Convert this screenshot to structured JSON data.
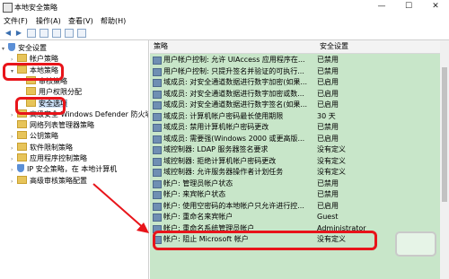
{
  "window": {
    "title": "本地安全策略",
    "min_label": "—",
    "max_label": "☐",
    "close_label": "✕"
  },
  "menu": [
    "文件(F)",
    "操作(A)",
    "查看(V)",
    "帮助(H)"
  ],
  "tree": [
    {
      "label": "安全设置",
      "indent": 0,
      "exp": "▾",
      "icon": "shield"
    },
    {
      "label": "帐户策略",
      "indent": 1,
      "exp": "›",
      "icon": "folder"
    },
    {
      "label": "本地策略",
      "indent": 1,
      "exp": "▾",
      "icon": "folder"
    },
    {
      "label": "审核策略",
      "indent": 2,
      "exp": "",
      "icon": "folder"
    },
    {
      "label": "用户权限分配",
      "indent": 2,
      "exp": "",
      "icon": "folder"
    },
    {
      "label": "安全选项",
      "indent": 2,
      "exp": "",
      "icon": "folder",
      "selected": true
    },
    {
      "label": "高级安全 Windows Defender 防火墙",
      "indent": 1,
      "exp": "›",
      "icon": "folder"
    },
    {
      "label": "网络列表管理器策略",
      "indent": 1,
      "exp": "",
      "icon": "folder"
    },
    {
      "label": "公钥策略",
      "indent": 1,
      "exp": "›",
      "icon": "folder"
    },
    {
      "label": "软件限制策略",
      "indent": 1,
      "exp": "›",
      "icon": "folder"
    },
    {
      "label": "应用程序控制策略",
      "indent": 1,
      "exp": "›",
      "icon": "folder"
    },
    {
      "label": "IP 安全策略，在 本地计算机",
      "indent": 1,
      "exp": "›",
      "icon": "shield"
    },
    {
      "label": "高级审核策略配置",
      "indent": 1,
      "exp": "›",
      "icon": "folder"
    }
  ],
  "columns": {
    "policy": "策略",
    "setting": "安全设置"
  },
  "policies": [
    {
      "name": "用户帐户控制: 允许 UIAccess 应用程序在...",
      "value": "已禁用"
    },
    {
      "name": "用户帐户控制: 只提升签名并验证的可执行...",
      "value": "已禁用"
    },
    {
      "name": "域成员: 对安全通道数据进行数字加密(如果...",
      "value": "已启用"
    },
    {
      "name": "域成员: 对安全通道数据进行数字加密或数...",
      "value": "已启用"
    },
    {
      "name": "域成员: 对安全通道数据进行数字签名(如果...",
      "value": "已启用"
    },
    {
      "name": "域成员: 计算机帐户密码最长使用期限",
      "value": "30 天"
    },
    {
      "name": "域成员: 禁用计算机帐户密码更改",
      "value": "已禁用"
    },
    {
      "name": "域成员: 需要强(Windows 2000 或更高版...",
      "value": "已启用"
    },
    {
      "name": "域控制器: LDAP 服务器签名要求",
      "value": "没有定义"
    },
    {
      "name": "域控制器: 拒绝计算机帐户密码更改",
      "value": "没有定义"
    },
    {
      "name": "域控制器: 允许服务器操作者计划任务",
      "value": "没有定义"
    },
    {
      "name": "帐户: 管理员帐户状态",
      "value": "已禁用"
    },
    {
      "name": "帐户: 来宾帐户状态",
      "value": "已禁用"
    },
    {
      "name": "帐户: 使用空密码的本地帐户只允许进行控...",
      "value": "已启用"
    },
    {
      "name": "帐户: 重命名来宾帐户",
      "value": "Guest"
    },
    {
      "name": "帐户: 重命名系统管理员帐户",
      "value": "Administrator",
      "highlight": true
    },
    {
      "name": "帐户: 阻止 Microsoft 帐户",
      "value": "没有定义"
    }
  ],
  "colors": {
    "annotation": "#e8141a",
    "policy_bg": "#c8e6c9",
    "tree_selected": "#cce0f7"
  }
}
